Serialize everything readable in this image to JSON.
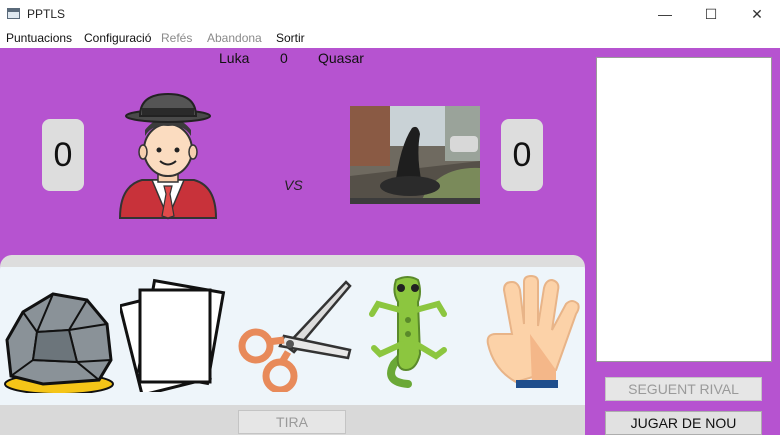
{
  "window": {
    "title": "PPTLS",
    "minimize_glyph": "—",
    "maximize_glyph": "☐",
    "close_glyph": "✕"
  },
  "menu": {
    "items": [
      "Puntuacions",
      "Configuració",
      "Refés",
      "Abandona",
      "Sortir"
    ],
    "disabled": [
      "Refés",
      "Abandona"
    ]
  },
  "header": {
    "player_name": "Luka",
    "round": "0",
    "rival_name": "Quasar"
  },
  "scores": {
    "player": "0",
    "rival": "0"
  },
  "vs_label": "VS",
  "choices": [
    {
      "name": "rock-icon"
    },
    {
      "name": "paper-icon"
    },
    {
      "name": "scissors-icon"
    },
    {
      "name": "lizard-icon"
    },
    {
      "name": "spock-icon"
    }
  ],
  "buttons": {
    "throw": "TIRA",
    "next_rival": "SEGUENT RIVAL",
    "play_again": "JUGAR DE NOU"
  },
  "colors": {
    "stage_bg": "#b653d0",
    "choices_bg": "#eef5fa"
  }
}
